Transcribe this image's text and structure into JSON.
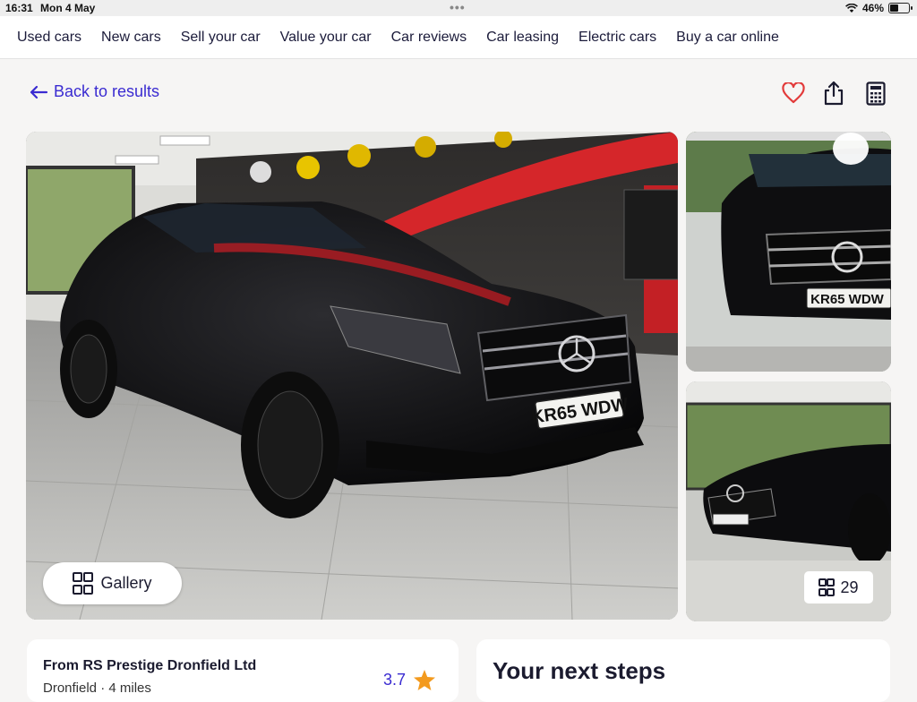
{
  "status_bar": {
    "time": "16:31",
    "date": "Mon 4 May",
    "battery": "46%"
  },
  "nav": {
    "items": [
      "Used cars",
      "New cars",
      "Sell your car",
      "Value your car",
      "Car reviews",
      "Car leasing",
      "Electric cars",
      "Buy a car online"
    ]
  },
  "back": {
    "label": "Back to results"
  },
  "gallery": {
    "button_label": "Gallery",
    "photo_count": "29",
    "plate": "KR65 WDW"
  },
  "dealer": {
    "name": "From RS Prestige Dronfield Ltd",
    "distance": "Dronfield · 4 miles",
    "rating": "3.7"
  },
  "next_steps": {
    "title": "Your next steps"
  },
  "colors": {
    "accent": "#3a2bd1",
    "heart": "#e23a3a"
  }
}
